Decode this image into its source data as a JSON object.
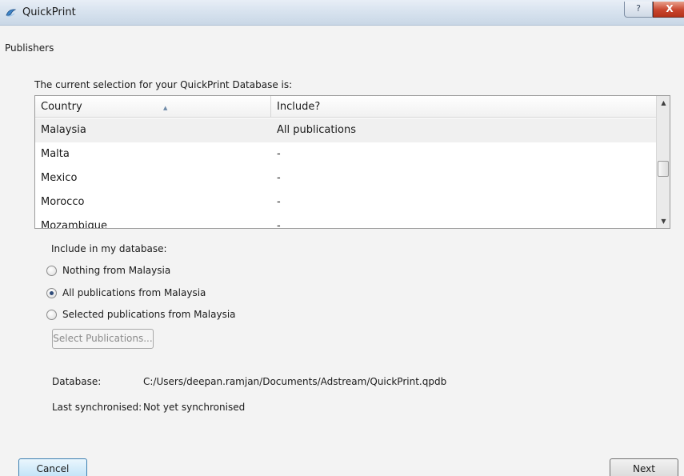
{
  "window": {
    "title": "QuickPrint",
    "help_glyph": "?",
    "close_glyph": "X"
  },
  "page": {
    "section_title": "Publishers",
    "selection_label": "The current selection for your QuickPrint Database is:"
  },
  "table": {
    "columns": [
      "Country",
      "Include?"
    ],
    "sort_column": "Country",
    "rows": [
      {
        "country": "Malaysia",
        "include": "All publications",
        "selected": true
      },
      {
        "country": "Malta",
        "include": "-",
        "selected": false
      },
      {
        "country": "Mexico",
        "include": "-",
        "selected": false
      },
      {
        "country": "Morocco",
        "include": "-",
        "selected": false
      },
      {
        "country": "Mozambique",
        "include": "-",
        "selected": false
      }
    ]
  },
  "include": {
    "label": "Include in my database:",
    "options": [
      {
        "label": "Nothing from Malaysia",
        "checked": false
      },
      {
        "label": "All publications from Malaysia",
        "checked": true
      },
      {
        "label": "Selected publications from Malaysia",
        "checked": false
      }
    ],
    "select_button": "Select Publications..."
  },
  "info": {
    "database_label": "Database:",
    "database_path": "C:/Users/deepan.ramjan/Documents/Adstream/QuickPrint.qpdb",
    "sync_label": "Last synchronised:",
    "sync_value": "Not yet synchronised"
  },
  "buttons": {
    "cancel": "Cancel",
    "next": "Next"
  },
  "colors": {
    "titlebar": "#d8e3ef",
    "close_button": "#c8452d",
    "selected_row": "#f0f0f0",
    "focus_border": "#3c7fb1"
  }
}
